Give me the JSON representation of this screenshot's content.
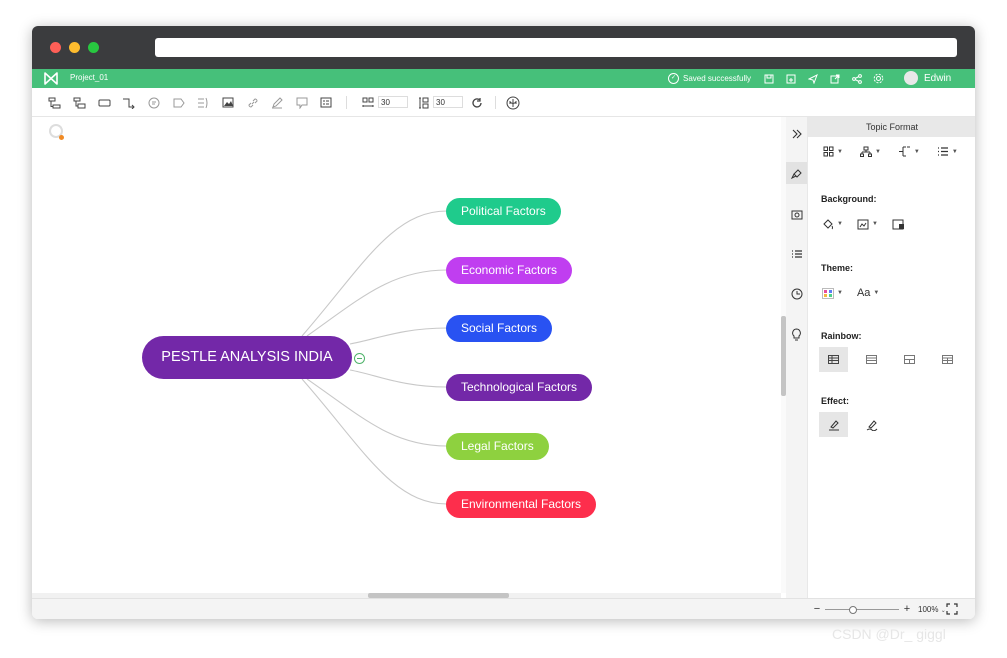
{
  "app": {
    "project_name": "Project_01",
    "save_status": "Saved successfully",
    "user_name": "Edwin",
    "brand_color": "#46c07a"
  },
  "toolbar": {
    "width_value": "30",
    "height_value": "30"
  },
  "mindmap": {
    "root": {
      "label": "PESTLE ANALYSIS INDIA",
      "color": "#7328a8"
    },
    "branches": [
      {
        "label": "Political Factors",
        "color": "#1fcb8c"
      },
      {
        "label": "Economic Factors",
        "color": "#c03ef0"
      },
      {
        "label": "Social Factors",
        "color": "#2952f2"
      },
      {
        "label": "Technological Factors",
        "color": "#7328a8"
      },
      {
        "label": "Legal Factors",
        "color": "#8ed13f"
      },
      {
        "label": "Environmental Factors",
        "color": "#fd2e4c"
      }
    ]
  },
  "panel": {
    "title": "Topic Format",
    "background_label": "Background:",
    "theme_label": "Theme:",
    "theme_font_label": "Aa",
    "rainbow_label": "Rainbow:",
    "effect_label": "Effect:"
  },
  "status": {
    "zoom": "100%"
  },
  "watermark": "CSDN @Dr_ giggl"
}
